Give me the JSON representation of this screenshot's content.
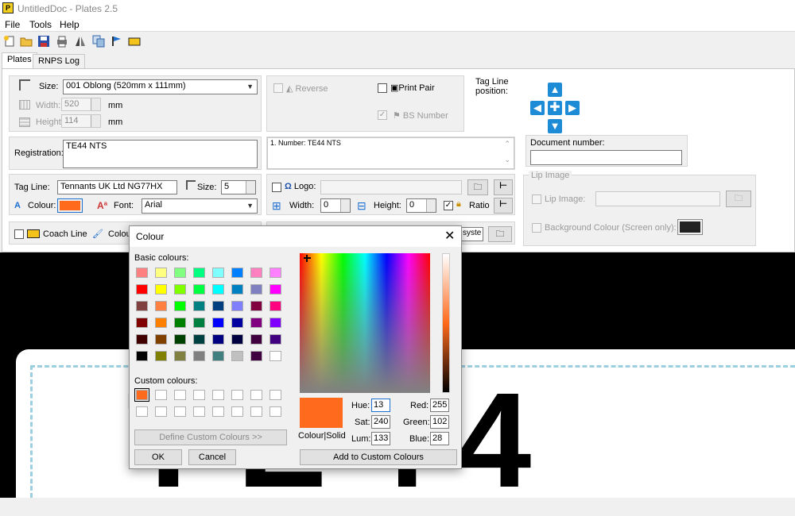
{
  "window": {
    "title": "UntitledDoc - Plates 2.5",
    "app_icon_letter": "P"
  },
  "menu": [
    "File",
    "Tools",
    "Help"
  ],
  "toolbar_icons": [
    "new-icon",
    "open-icon",
    "save-icon",
    "print-icon",
    "mirror-icon",
    "copy-icon",
    "flag-icon",
    "plate-icon"
  ],
  "tabs": [
    "Plates",
    "RNPS Log"
  ],
  "plate": {
    "size_label": "Size:",
    "size_value": "001 Oblong (520mm x 111mm)",
    "width_label": "Width:",
    "width_value": "520",
    "height_label": "Height:",
    "height_value": "114",
    "unit": "mm",
    "registration_label": "Registration:",
    "registration_value": "TE44 NTS",
    "number_preview": "1. Number: TE44 NTS",
    "tagline_label": "Tag Line:",
    "tagline_value": "Tennants UK Ltd NG77HX",
    "tagline_size_label": "Size:",
    "tagline_size_value": "5",
    "colour_label": "Colour:",
    "colour_value": "#ff6a1c",
    "font_label": "Font:",
    "font_value": "Arial",
    "coach_line_label": "Coach Line",
    "colour_partial_label": "Colour",
    "system_partial": "syste"
  },
  "options": {
    "reverse_label": "Reverse",
    "print_pair_label": "Print Pair",
    "bs_number_label": "BS Number",
    "logo_label": "Logo:",
    "width_label": "Width:",
    "width_value": "0",
    "height_label": "Height:",
    "height_value": "0",
    "ratio_label": "Ratio"
  },
  "tagline_position": {
    "label_line1": "Tag Line",
    "label_line2": "position:"
  },
  "document_number": {
    "label": "Document number:",
    "value": ""
  },
  "lip_image": {
    "group_label": "Lip Image",
    "lip_image_label": "Lip Image:",
    "background_label": "Background Colour (Screen only):",
    "background_colour": "#222222"
  },
  "preview_text": "TE44",
  "colour_dialog": {
    "title": "Colour",
    "basic_label": "Basic colours:",
    "basic_colours": [
      "#ff8080",
      "#ffff80",
      "#80ff80",
      "#00ff80",
      "#80ffff",
      "#0080ff",
      "#ff80c0",
      "#ff80ff",
      "#ff0000",
      "#ffff00",
      "#80ff00",
      "#00ff40",
      "#00ffff",
      "#0080c0",
      "#8080c0",
      "#ff00ff",
      "#804040",
      "#ff8040",
      "#00ff00",
      "#008080",
      "#004080",
      "#8080ff",
      "#800040",
      "#ff0080",
      "#800000",
      "#ff8000",
      "#008000",
      "#008040",
      "#0000ff",
      "#0000a0",
      "#800080",
      "#8000ff",
      "#400000",
      "#804000",
      "#004000",
      "#004040",
      "#000080",
      "#000040",
      "#400040",
      "#400080",
      "#000000",
      "#808000",
      "#808040",
      "#808080",
      "#408080",
      "#c0c0c0",
      "#400040",
      "#ffffff"
    ],
    "custom_label": "Custom colours:",
    "custom_first": "#ff6a1c",
    "define_button": "Define Custom Colours >>",
    "ok_button": "OK",
    "cancel_button": "Cancel",
    "colour_solid_label": "Colour|Solid",
    "current_colour": "#ff6a1c",
    "hue_label": "Hue:",
    "hue_value": "13",
    "sat_label": "Sat:",
    "sat_value": "240",
    "lum_label": "Lum:",
    "lum_value": "133",
    "red_label": "Red:",
    "red_value": "255",
    "green_label": "Green:",
    "green_value": "102",
    "blue_label": "Blue:",
    "blue_value": "28",
    "add_button": "Add to Custom Colours"
  }
}
